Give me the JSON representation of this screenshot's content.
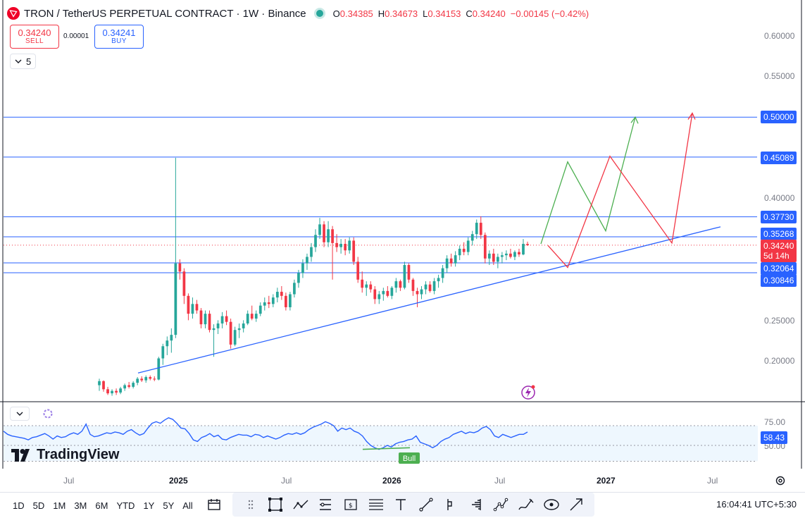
{
  "header": {
    "symbol_title": "TRON / TetherUS PERPETUAL CONTRACT · 1W · Binance",
    "ohlc": {
      "o_label": "O",
      "o": "0.34385",
      "h_label": "H",
      "h": "0.34673",
      "l_label": "L",
      "l": "0.34153",
      "c_label": "C",
      "c": "0.34240",
      "change": "−0.00145 (−0.42%)"
    }
  },
  "trade": {
    "sell_price": "0.34240",
    "sell_label": "SELL",
    "spread": "0.00001",
    "buy_price": "0.34241",
    "buy_label": "BUY"
  },
  "indicators_collapse": {
    "count": "5"
  },
  "price_axis": [
    "0.60000",
    "0.55000",
    "0.40000",
    "0.25000",
    "0.20000"
  ],
  "price_tags": {
    "level_050": "0.50000",
    "level_045": "0.45089",
    "level_0377": "0.37730",
    "level_0352": "0.35268",
    "current": "0.34240",
    "countdown": "5d 14h",
    "level_0320": "0.32064",
    "level_0308": "0.30846"
  },
  "rsi": {
    "axis_75": "75.00",
    "axis_50": "50.00",
    "value": "58.43",
    "bull_label": "Bull",
    "values": [
      68,
      64,
      62,
      61,
      60,
      59,
      57,
      60,
      61,
      63,
      65,
      62,
      58,
      62,
      60,
      61,
      64,
      66,
      64,
      68,
      77,
      64,
      61,
      62,
      64,
      66,
      65,
      67,
      66,
      64,
      68,
      70,
      66,
      63,
      65,
      72,
      78,
      80,
      78,
      82,
      85,
      83,
      78,
      72,
      71,
      65,
      57,
      55,
      60,
      62,
      65,
      61,
      63,
      58,
      57,
      60,
      62,
      64,
      63,
      63,
      61,
      64,
      63,
      60,
      62,
      60,
      58,
      60,
      63,
      65,
      64,
      66,
      64,
      66,
      70,
      73,
      75,
      77,
      80,
      78,
      75,
      68,
      72,
      70,
      72,
      68,
      66,
      62,
      55,
      50,
      47,
      45,
      47,
      50,
      48,
      52,
      54,
      55,
      57,
      58,
      62,
      54,
      52,
      50,
      47,
      50,
      55,
      58,
      60,
      64,
      66,
      68,
      65,
      67,
      66,
      68,
      72,
      74,
      70,
      62,
      60,
      64,
      62,
      60,
      62,
      64,
      64,
      67
    ]
  },
  "time_axis": {
    "jul_1": "Jul",
    "y2025": "2025",
    "jul_2": "Jul",
    "y2026": "2026",
    "jul_3": "Jul",
    "y2027": "2027",
    "jul_4": "Jul"
  },
  "brand": {
    "name": "TradingView"
  },
  "bottom": {
    "timeframes": [
      "1D",
      "5D",
      "1M",
      "3M",
      "6M",
      "YTD",
      "1Y",
      "5Y",
      "All"
    ],
    "clock": "16:04:41 UTC+5:30"
  },
  "colors": {
    "up": "#26a69a",
    "down": "#f23645",
    "line": "#2962ff",
    "green_proj": "#4caf50",
    "red_proj": "#f23645",
    "rsi_line": "#2962ff"
  },
  "chart_data": {
    "type": "candlestick",
    "interval": "1W",
    "y_range": [
      0.155,
      0.62
    ],
    "horizontal_levels": [
      0.5,
      0.45089,
      0.3773,
      0.35268,
      0.32064,
      0.30846
    ],
    "ohlc": [
      [
        0.17,
        0.178,
        0.163,
        0.175
      ],
      [
        0.175,
        0.176,
        0.162,
        0.165
      ],
      [
        0.165,
        0.168,
        0.158,
        0.16
      ],
      [
        0.16,
        0.165,
        0.157,
        0.163
      ],
      [
        0.163,
        0.166,
        0.158,
        0.161
      ],
      [
        0.161,
        0.168,
        0.159,
        0.166
      ],
      [
        0.166,
        0.172,
        0.163,
        0.17
      ],
      [
        0.17,
        0.174,
        0.166,
        0.168
      ],
      [
        0.168,
        0.175,
        0.166,
        0.173
      ],
      [
        0.173,
        0.18,
        0.17,
        0.178
      ],
      [
        0.178,
        0.181,
        0.174,
        0.176
      ],
      [
        0.176,
        0.182,
        0.173,
        0.18
      ],
      [
        0.18,
        0.182,
        0.176,
        0.178
      ],
      [
        0.178,
        0.181,
        0.175,
        0.177
      ],
      [
        0.177,
        0.205,
        0.176,
        0.203
      ],
      [
        0.203,
        0.221,
        0.195,
        0.218
      ],
      [
        0.218,
        0.23,
        0.207,
        0.225
      ],
      [
        0.225,
        0.24,
        0.21,
        0.232
      ],
      [
        0.232,
        0.45,
        0.228,
        0.32
      ],
      [
        0.32,
        0.325,
        0.3,
        0.31
      ],
      [
        0.31,
        0.314,
        0.27,
        0.28
      ],
      [
        0.28,
        0.283,
        0.25,
        0.258
      ],
      [
        0.258,
        0.278,
        0.252,
        0.27
      ],
      [
        0.27,
        0.275,
        0.258,
        0.262
      ],
      [
        0.262,
        0.265,
        0.24,
        0.245
      ],
      [
        0.245,
        0.262,
        0.24,
        0.258
      ],
      [
        0.258,
        0.262,
        0.235,
        0.238
      ],
      [
        0.238,
        0.245,
        0.205,
        0.24
      ],
      [
        0.24,
        0.25,
        0.233,
        0.246
      ],
      [
        0.246,
        0.26,
        0.24,
        0.255
      ],
      [
        0.255,
        0.262,
        0.244,
        0.248
      ],
      [
        0.248,
        0.252,
        0.215,
        0.22
      ],
      [
        0.22,
        0.242,
        0.218,
        0.238
      ],
      [
        0.238,
        0.246,
        0.228,
        0.24
      ],
      [
        0.24,
        0.25,
        0.235,
        0.246
      ],
      [
        0.246,
        0.262,
        0.244,
        0.258
      ],
      [
        0.258,
        0.268,
        0.25,
        0.252
      ],
      [
        0.252,
        0.262,
        0.248,
        0.258
      ],
      [
        0.258,
        0.272,
        0.255,
        0.268
      ],
      [
        0.268,
        0.278,
        0.262,
        0.272
      ],
      [
        0.272,
        0.28,
        0.265,
        0.27
      ],
      [
        0.27,
        0.282,
        0.266,
        0.278
      ],
      [
        0.278,
        0.29,
        0.272,
        0.285
      ],
      [
        0.285,
        0.292,
        0.275,
        0.28
      ],
      [
        0.28,
        0.284,
        0.262,
        0.266
      ],
      [
        0.266,
        0.285,
        0.262,
        0.282
      ],
      [
        0.282,
        0.3,
        0.278,
        0.296
      ],
      [
        0.296,
        0.312,
        0.29,
        0.308
      ],
      [
        0.308,
        0.325,
        0.302,
        0.32
      ],
      [
        0.32,
        0.332,
        0.312,
        0.328
      ],
      [
        0.328,
        0.345,
        0.322,
        0.34
      ],
      [
        0.34,
        0.362,
        0.334,
        0.355
      ],
      [
        0.355,
        0.376,
        0.35,
        0.368
      ],
      [
        0.368,
        0.372,
        0.34,
        0.346
      ],
      [
        0.346,
        0.372,
        0.34,
        0.362
      ],
      [
        0.362,
        0.366,
        0.3,
        0.345
      ],
      [
        0.345,
        0.356,
        0.334,
        0.34
      ],
      [
        0.34,
        0.35,
        0.332,
        0.344
      ],
      [
        0.344,
        0.35,
        0.33,
        0.336
      ],
      [
        0.336,
        0.352,
        0.332,
        0.348
      ],
      [
        0.348,
        0.352,
        0.318,
        0.322
      ],
      [
        0.322,
        0.328,
        0.296,
        0.3
      ],
      [
        0.3,
        0.31,
        0.284,
        0.29
      ],
      [
        0.29,
        0.298,
        0.28,
        0.294
      ],
      [
        0.294,
        0.298,
        0.284,
        0.288
      ],
      [
        0.288,
        0.292,
        0.27,
        0.276
      ],
      [
        0.276,
        0.286,
        0.27,
        0.282
      ],
      [
        0.282,
        0.29,
        0.274,
        0.286
      ],
      [
        0.286,
        0.292,
        0.278,
        0.28
      ],
      [
        0.28,
        0.292,
        0.276,
        0.29
      ],
      [
        0.29,
        0.302,
        0.284,
        0.298
      ],
      [
        0.298,
        0.3,
        0.286,
        0.29
      ],
      [
        0.29,
        0.322,
        0.288,
        0.318
      ],
      [
        0.318,
        0.32,
        0.296,
        0.3
      ],
      [
        0.3,
        0.302,
        0.28,
        0.286
      ],
      [
        0.286,
        0.29,
        0.266,
        0.282
      ],
      [
        0.282,
        0.292,
        0.276,
        0.288
      ],
      [
        0.288,
        0.298,
        0.282,
        0.294
      ],
      [
        0.294,
        0.298,
        0.284,
        0.286
      ],
      [
        0.286,
        0.302,
        0.282,
        0.298
      ],
      [
        0.298,
        0.306,
        0.29,
        0.302
      ],
      [
        0.302,
        0.318,
        0.296,
        0.314
      ],
      [
        0.314,
        0.33,
        0.308,
        0.326
      ],
      [
        0.326,
        0.332,
        0.316,
        0.32
      ],
      [
        0.32,
        0.335,
        0.316,
        0.33
      ],
      [
        0.33,
        0.342,
        0.324,
        0.338
      ],
      [
        0.338,
        0.346,
        0.33,
        0.334
      ],
      [
        0.334,
        0.352,
        0.33,
        0.348
      ],
      [
        0.348,
        0.36,
        0.342,
        0.356
      ],
      [
        0.356,
        0.374,
        0.35,
        0.37
      ],
      [
        0.37,
        0.378,
        0.35,
        0.355
      ],
      [
        0.355,
        0.358,
        0.32,
        0.326
      ],
      [
        0.326,
        0.336,
        0.318,
        0.332
      ],
      [
        0.332,
        0.338,
        0.318,
        0.322
      ],
      [
        0.322,
        0.332,
        0.314,
        0.328
      ],
      [
        0.328,
        0.334,
        0.32,
        0.33
      ],
      [
        0.33,
        0.336,
        0.324,
        0.332
      ],
      [
        0.332,
        0.338,
        0.326,
        0.328
      ],
      [
        0.328,
        0.336,
        0.324,
        0.334
      ],
      [
        0.334,
        0.338,
        0.328,
        0.331
      ],
      [
        0.331,
        0.35,
        0.33,
        0.344
      ],
      [
        0.3439,
        0.3467,
        0.3415,
        0.3424
      ]
    ],
    "trendline": [
      [
        0.185,
        0.365
      ],
      [
        0.0,
        1.0
      ]
    ],
    "green_projection": [
      0.344,
      0.445,
      0.36,
      0.5
    ],
    "red_projection": [
      0.342,
      0.315,
      0.452,
      0.345,
      0.505
    ]
  }
}
